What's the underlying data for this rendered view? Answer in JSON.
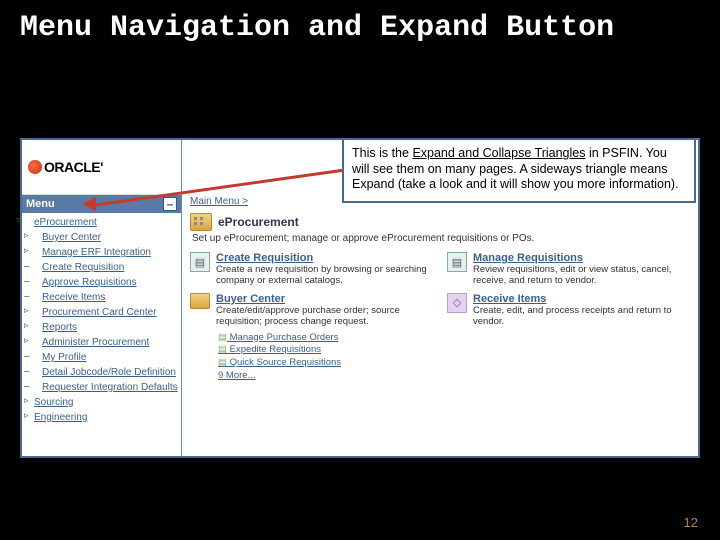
{
  "slide": {
    "title": "Menu Navigation and Expand Button",
    "page_number": "12"
  },
  "callout": {
    "line1_pre": "This is the ",
    "line1_u": "Expand and Collapse Triangles",
    "line1_post": " in PSFIN. You will see them on many pages. A sideways triangle means Expand (take a look and it will show you more information)."
  },
  "logo": {
    "text": "ORACLE'"
  },
  "sidebar": {
    "header": "Menu",
    "top_item": "eProcurement",
    "eproc_items": [
      "Buyer Center",
      "Manage ERF Integration",
      "Create Requisition",
      "Approve Requisitions",
      "Receive Items",
      "Procurement Card Center",
      "Reports",
      "Administer Procurement",
      "My Profile",
      "Detail Jobcode/Role Definition",
      "Requester Integration Defaults"
    ],
    "after_eproc": [
      "Sourcing",
      "Engineering"
    ]
  },
  "main": {
    "breadcrumb": "Main Menu >",
    "section_title": "eProcurement",
    "section_desc": "Set up eProcurement; manage or approve eProcurement requisitions or POs.",
    "cards": {
      "create_req": {
        "title": "Create Requisition",
        "desc": "Create a new requisition by browsing or searching company or external catalogs."
      },
      "manage_req": {
        "title": "Manage Requisitions",
        "desc": "Review requisitions, edit or view status, cancel, receive, and return to vendor."
      },
      "buyer_center": {
        "title": "Buyer Center",
        "desc": "Create/edit/approve purchase order; source requisition; process change request."
      },
      "receive_items": {
        "title": "Receive Items",
        "desc": "Create, edit, and process receipts and return to vendor."
      }
    },
    "sublinks": {
      "l1": "Manage Purchase Orders",
      "l2": "Expedite Requisitions",
      "l3": "Quick Source Requisitions",
      "more": "9 More..."
    }
  }
}
